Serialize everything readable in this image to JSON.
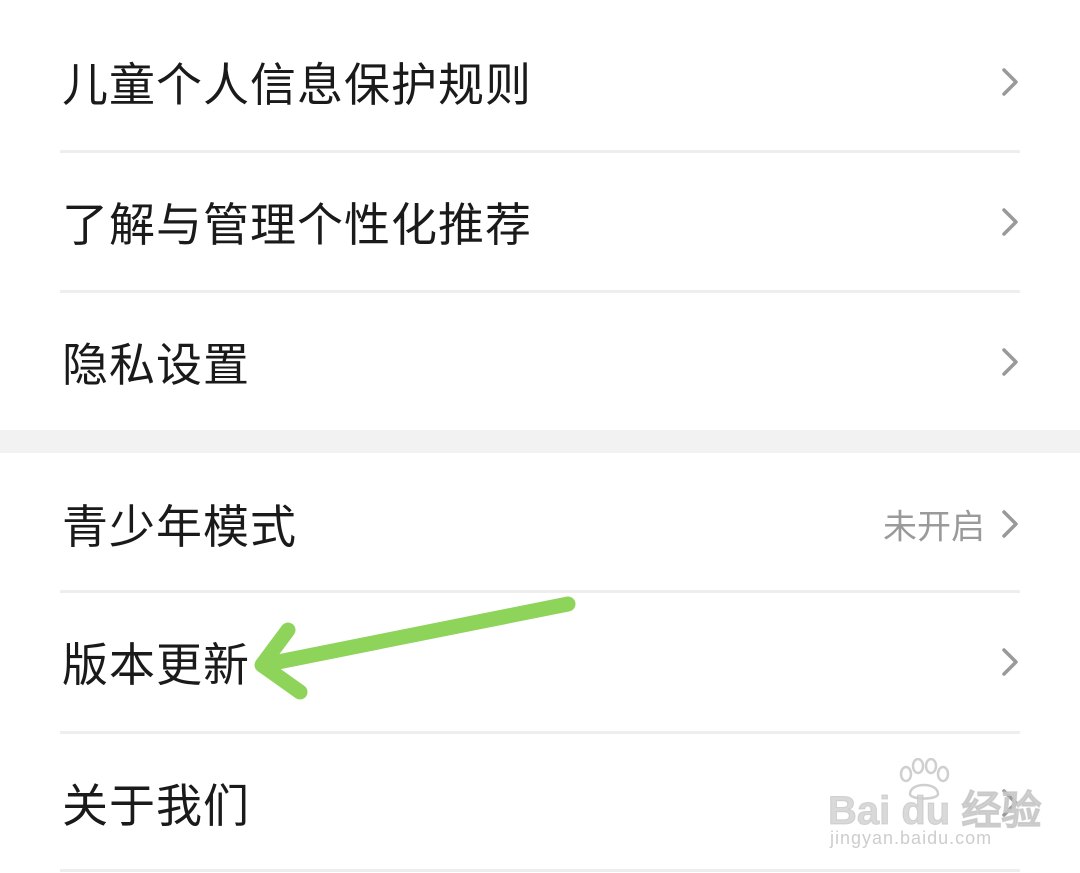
{
  "settings": {
    "group1": [
      {
        "label": "儿童个人信息保护规则"
      },
      {
        "label": "了解与管理个性化推荐"
      },
      {
        "label": "隐私设置"
      }
    ],
    "group2": [
      {
        "label": "青少年模式",
        "value": "未开启"
      },
      {
        "label": "版本更新"
      },
      {
        "label": "关于我们"
      }
    ]
  },
  "icons": {
    "chevron": "chevron-right-icon",
    "annotation": "green-arrow-icon"
  },
  "colors": {
    "text": "#1a1a1a",
    "secondary_text": "#9a9a9a",
    "divider": "#eeeeee",
    "section_gap": "#f2f2f2",
    "chevron": "#999999",
    "arrow": "#8ed45a"
  },
  "watermark": {
    "logo": "Bai du 经验",
    "url": "jingyan.baidu.com"
  }
}
